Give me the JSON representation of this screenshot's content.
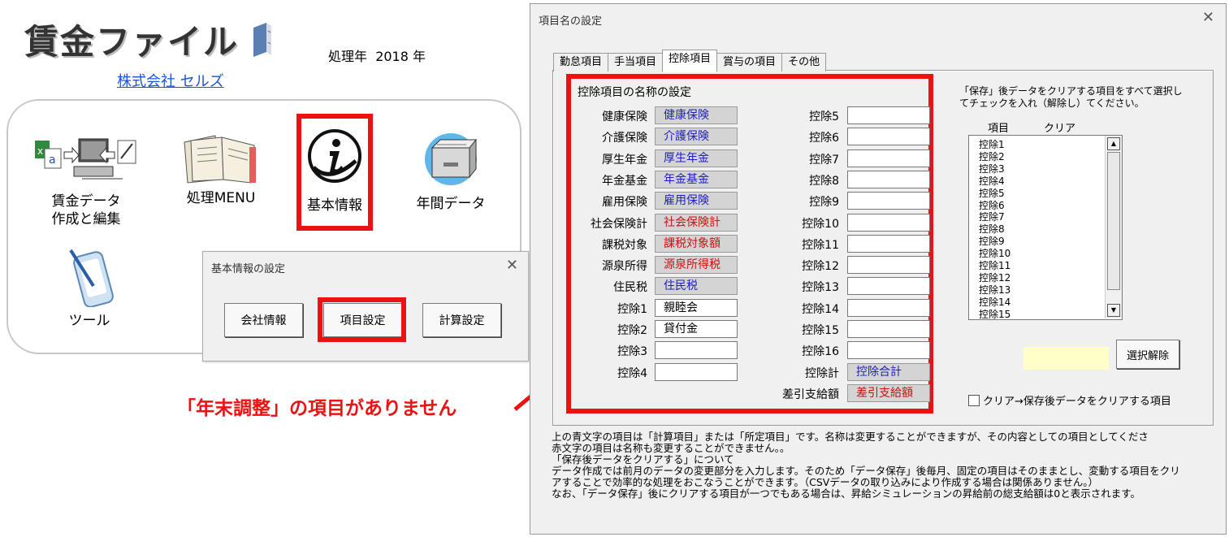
{
  "app": {
    "title": "賃金ファイル",
    "year_label": "処理年",
    "year_value": "2018 年",
    "company": "株式会社 セルズ"
  },
  "menu": [
    {
      "label": "賃金データ\n作成と編集",
      "icon": "data-edit-icon"
    },
    {
      "label": "処理MENU",
      "icon": "books-icon"
    },
    {
      "label": "基本情報",
      "icon": "info-icon"
    },
    {
      "label": "年間データ",
      "icon": "file-cabinet-icon"
    },
    {
      "label": "ツール",
      "icon": "pen-tablet-icon"
    }
  ],
  "kihon_dialog": {
    "title": "基本情報の設定",
    "close": "✕",
    "buttons": [
      "会社情報",
      "項目設定",
      "計算設定"
    ]
  },
  "annotation": "「年末調整」の項目がありません",
  "main_dialog": {
    "title": "項目名の設定",
    "close": "✕",
    "tabs": [
      "勤怠項目",
      "手当項目",
      "控除項目",
      "賞与の項目",
      "その他"
    ],
    "active_tab": "控除項目",
    "group_title": "控除項目の名称の設定",
    "left_fields": [
      {
        "label": "健康保険",
        "value": "健康保険",
        "kind": "calc"
      },
      {
        "label": "介護保険",
        "value": "介護保険",
        "kind": "calc"
      },
      {
        "label": "厚生年金",
        "value": "厚生年金",
        "kind": "calc"
      },
      {
        "label": "年金基金",
        "value": "年金基金",
        "kind": "calc"
      },
      {
        "label": "雇用保険",
        "value": "雇用保険",
        "kind": "calc"
      },
      {
        "label": "社会保険計",
        "value": "社会保険計",
        "kind": "fixed"
      },
      {
        "label": "課税対象",
        "value": "課税対象額",
        "kind": "fixed"
      },
      {
        "label": "源泉所得",
        "value": "源泉所得税",
        "kind": "fixed"
      },
      {
        "label": "住民税",
        "value": "住民税",
        "kind": "calc"
      },
      {
        "label": "控除1",
        "value": "親睦会",
        "kind": "edit"
      },
      {
        "label": "控除2",
        "value": "貸付金",
        "kind": "edit"
      },
      {
        "label": "控除3",
        "value": "",
        "kind": "edit"
      },
      {
        "label": "控除4",
        "value": "",
        "kind": "edit"
      }
    ],
    "right_fields": [
      {
        "label": "控除5",
        "value": "",
        "kind": "edit"
      },
      {
        "label": "控除6",
        "value": "",
        "kind": "edit"
      },
      {
        "label": "控除7",
        "value": "",
        "kind": "edit"
      },
      {
        "label": "控除8",
        "value": "",
        "kind": "edit"
      },
      {
        "label": "控除9",
        "value": "",
        "kind": "edit"
      },
      {
        "label": "控除10",
        "value": "",
        "kind": "edit"
      },
      {
        "label": "控除11",
        "value": "",
        "kind": "edit"
      },
      {
        "label": "控除12",
        "value": "",
        "kind": "edit"
      },
      {
        "label": "控除13",
        "value": "",
        "kind": "edit"
      },
      {
        "label": "控除14",
        "value": "",
        "kind": "edit"
      },
      {
        "label": "控除15",
        "value": "",
        "kind": "edit"
      },
      {
        "label": "控除16",
        "value": "",
        "kind": "edit"
      },
      {
        "label": "控除計",
        "value": "控除合計",
        "kind": "calc"
      },
      {
        "label": "差引支給額",
        "value": "差引支給額",
        "kind": "fixed"
      }
    ],
    "clear_instruction": "「保存」後データをクリアする項目をすべて選択してチェックを入れ（解除し）てください。",
    "list_headers": {
      "item": "項目",
      "clear": "クリア"
    },
    "clear_list": [
      "控除1",
      "控除2",
      "控除3",
      "控除4",
      "控除5",
      "控除6",
      "控除7",
      "控除8",
      "控除9",
      "控除10",
      "控除11",
      "控除12",
      "控除13",
      "控除14",
      "控除15"
    ],
    "deselect_button": "選択解除",
    "clear_checkbox_label": "クリア→保存後データをクリアする項目",
    "notes": [
      "上の青文字の項目は「計算項目」または「所定項目」です。名称は変更することができますが、その内容としての項目としてくださ",
      "赤文字の項目は名称も変更することができません。。",
      "「保存後データをクリアする」について",
      "データ作成では前月のデータの変更部分を入力します。そのため「データ保存」後毎月、固定の項目はそのままとし、変動する項目をクリ",
      "アすることで効率的な処理をおこなうことができます。（CSVデータの取り込みにより作成する場合は関係ありません。）",
      "なお、「データ保存」後にクリアする項目が一つでもある場合は、昇給シミュレーションの昇給前の総支給額は0と表示されます。"
    ]
  },
  "colors": {
    "highlight": "#ee1111",
    "calc_text": "#1f1fbf",
    "fixed_text": "#cc1111",
    "link": "#1a55d8"
  }
}
